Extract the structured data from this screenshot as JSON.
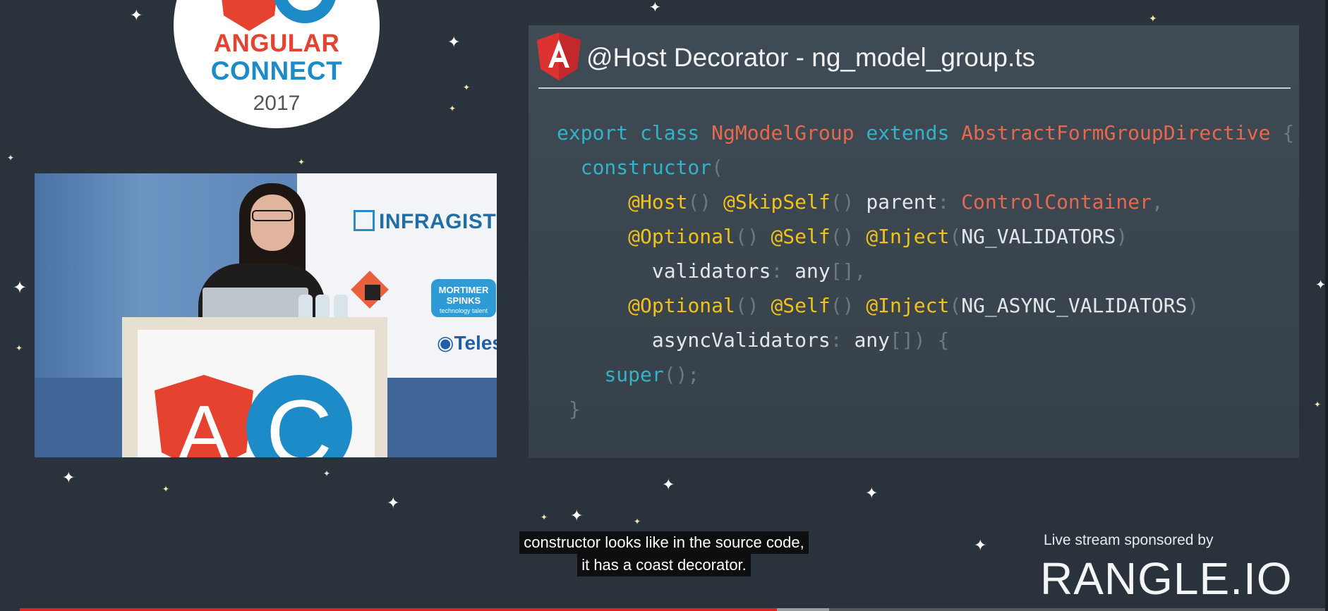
{
  "conference": {
    "logo_line1": "ANGULAR",
    "logo_line2": "CONNECT",
    "year": "2017",
    "brand_colors": {
      "red": "#e5432f",
      "blue": "#1e8bc9"
    }
  },
  "video": {
    "sponsor_banners": [
      "INFRAGISTIC",
      "MORTIMER SPINKS",
      "technology talent",
      "Teles"
    ],
    "podium_logo": [
      "A",
      "C"
    ]
  },
  "slide": {
    "title": "@Host Decorator - ng_model_group.ts",
    "icon": "angular-shield-icon",
    "code_lines": [
      "export class NgModelGroup extends AbstractFormGroupDirective {",
      "  constructor(",
      "      @Host() @SkipSelf() parent: ControlContainer,",
      "      @Optional() @Self() @Inject(NG_VALIDATORS)",
      "        validators: any[],",
      "      @Optional() @Self() @Inject(NG_ASYNC_VALIDATORS)",
      "        asyncValidators: any[]) {",
      "    super();",
      " }"
    ]
  },
  "captions": {
    "line1": "constructor looks like in the source code,",
    "line2": "it has a coast decorator."
  },
  "sponsor": {
    "label": "Live stream sponsored by",
    "brand": "RANGLE.IO"
  },
  "player": {
    "progress": 0.58,
    "buffered": 0.62,
    "colors": {
      "played": "#e02424",
      "buffer": "#9a9ea3"
    }
  }
}
